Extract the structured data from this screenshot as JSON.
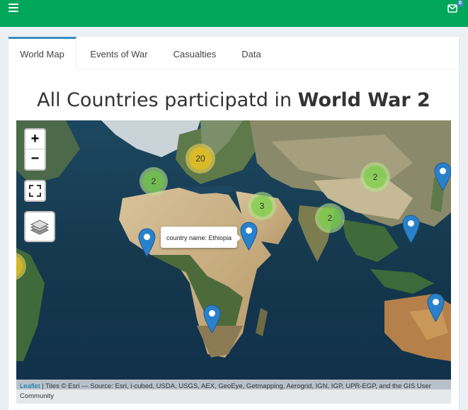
{
  "header": {
    "menu_icon": "hamburger-icon",
    "mail_icon": "envelope-icon",
    "mail_count": "0",
    "bar_color": "#00a65a"
  },
  "tabs": [
    {
      "label": "World Map",
      "active": true
    },
    {
      "label": "Events of War",
      "active": false
    },
    {
      "label": "Casualties",
      "active": false
    },
    {
      "label": "Data",
      "active": false
    }
  ],
  "title": {
    "prefix": "All Countries participatd in ",
    "emphasis": "World War 2"
  },
  "map": {
    "zoom_in_label": "+",
    "zoom_out_label": "−",
    "fullscreen_icon": "fullscreen-icon",
    "layers_icon": "layers-icon",
    "clusters": [
      {
        "count": "20",
        "size": "medium"
      },
      {
        "count": "2",
        "size": "small"
      },
      {
        "count": "3",
        "size": "small"
      },
      {
        "count": "2",
        "size": "small"
      },
      {
        "count": "2",
        "size": "small"
      }
    ],
    "marker_icon": "map-pin-icon",
    "marker_color": "#2a81cb",
    "tooltip": "country name: Ethiopia",
    "attribution": {
      "link": "Leaflet",
      "text": " | Tiles © Esri — Source: Esri, i-cubed, USDA, USGS, AEX, GeoEye, Getmapping, Aerogrid, IGN, IGP, UPR-EGP, and the GIS User Community"
    }
  }
}
